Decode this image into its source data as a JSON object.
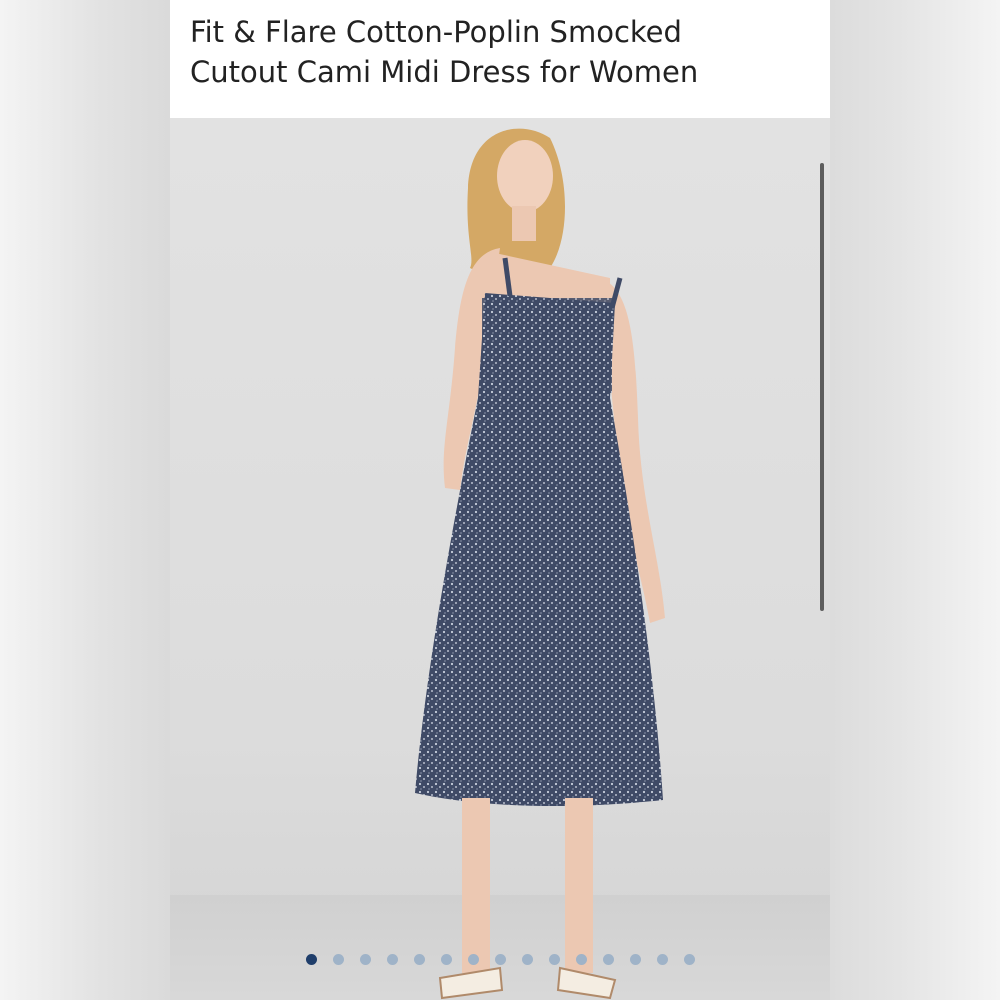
{
  "product": {
    "title_line1": "Fit & Flare Cotton-Poplin Smocked",
    "title_line2": "Cutout Cami Midi Dress for Women"
  },
  "gallery": {
    "image_count": 15,
    "active_index": 0,
    "colors": {
      "dot_active": "#1f3e6b",
      "dot_inactive": "#9fb3c8",
      "dress": "#4a5570"
    }
  }
}
